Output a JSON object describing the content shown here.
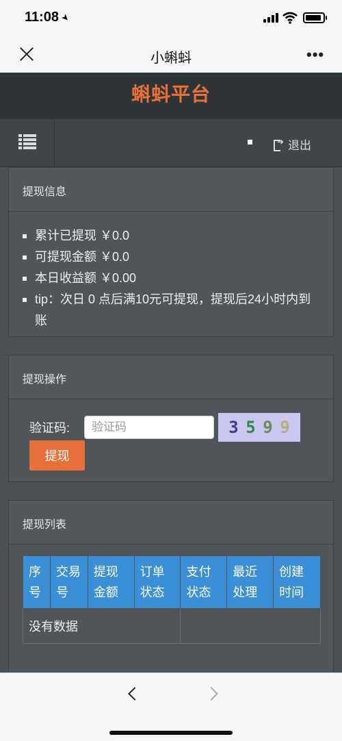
{
  "status_bar": {
    "time": "11:08"
  },
  "nav": {
    "title": "小蝌蚪"
  },
  "header": {
    "brand": "蝌蚪平台"
  },
  "toolbar": {
    "logout_label": "退出"
  },
  "withdraw_info": {
    "title": "提现信息",
    "items": [
      "累计已提现 ￥0.0",
      "可提现金额 ￥0.0",
      "本日收益额 ￥0.00",
      "tip：次日 0 点后满10元可提现，提现后24小时内到账"
    ]
  },
  "withdraw_action": {
    "title": "提现操作",
    "captcha_label": "验证码:",
    "captcha_placeholder": "验证码",
    "captcha_code": [
      "3",
      "5",
      "9",
      "9"
    ],
    "submit_label": "提现"
  },
  "withdraw_list": {
    "title": "提现列表",
    "columns": [
      "序号",
      "交易号",
      "提现金额",
      "订单状态",
      "支付状态",
      "最近处理",
      "创建时间"
    ],
    "empty_text": "没有数据"
  },
  "colors": {
    "brand": "#e8703a",
    "table_header": "#3a8fd6",
    "panel": "#4f5558"
  }
}
